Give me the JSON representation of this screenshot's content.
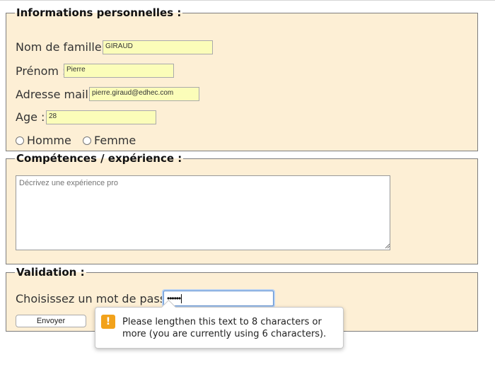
{
  "section_personal": {
    "legend": "Informations personnelles :",
    "nom_label": "Nom de famille :",
    "nom_value": "GIRAUD",
    "prenom_label": "Prénom :",
    "prenom_value": "Pierre",
    "email_label": "Adresse mail :",
    "email_value": "pierre.giraud@edhec.com",
    "age_label": "Age :",
    "age_value": "28",
    "gender_options": [
      "Homme",
      "Femme"
    ]
  },
  "section_experience": {
    "legend": "Compétences / expérience :",
    "placeholder": "Décrivez une expérience pro"
  },
  "section_validation": {
    "legend": "Validation :",
    "password_label": "Choisissez un mot de passe :",
    "password_masked": "••••••",
    "submit_label": "Envoyer"
  },
  "tooltip": {
    "icon": "warning-icon",
    "message": "Please lengthen this text to 8 characters or more (you are currently using 6 characters)."
  },
  "colors": {
    "fieldset_bg": "#fdefd5",
    "input_bg": "#fbfdb9",
    "warning": "#f2a21b",
    "focus_ring": "#5d8fd0"
  }
}
